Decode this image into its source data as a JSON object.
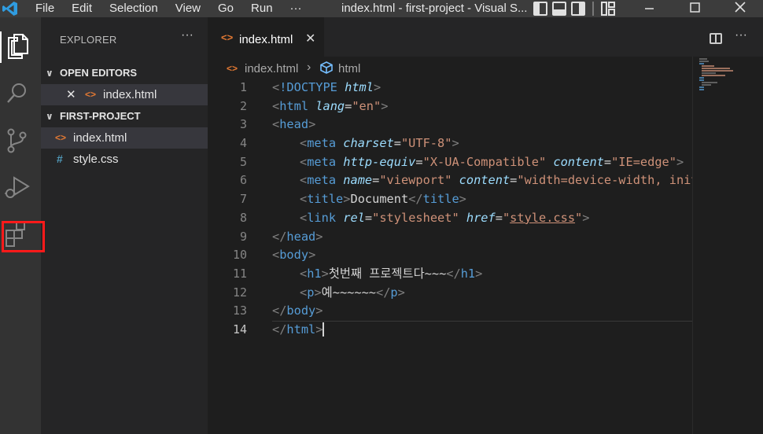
{
  "titlebar": {
    "menu": [
      "File",
      "Edit",
      "Selection",
      "View",
      "Go",
      "Run",
      "···"
    ],
    "window_title": "index.html - first-project - Visual S..."
  },
  "activity_bar": {
    "items": [
      "explorer-icon",
      "search-icon",
      "source-control-icon",
      "run-debug-icon",
      "extensions-icon"
    ],
    "highlight_color": "#ff1a1a"
  },
  "sidebar": {
    "title": "EXPLORER",
    "more": "···",
    "open_editors": {
      "label": "OPEN EDITORS",
      "items": [
        {
          "close": "✕",
          "icon": "<>",
          "name": "index.html"
        }
      ]
    },
    "project": {
      "label": "FIRST-PROJECT",
      "files": [
        {
          "icon": "<>",
          "name": "index.html"
        },
        {
          "icon": "#",
          "name": "style.css"
        }
      ]
    }
  },
  "editor": {
    "tab": {
      "icon": "<>",
      "label": "index.html",
      "close": "✕"
    },
    "tab_more": "···",
    "breadcrumb": {
      "file": "index.html",
      "separator": "›",
      "symbol": "html"
    },
    "line_numbers": [
      "1",
      "2",
      "3",
      "4",
      "5",
      "6",
      "7",
      "8",
      "9",
      "10",
      "11",
      "12",
      "13",
      "14"
    ],
    "current_line": 14,
    "code": {
      "doctype": "!DOCTYPE",
      "doctype_html": "html",
      "html": "html",
      "lang_attr": "lang",
      "lang_val": "\"en\"",
      "head": "head",
      "meta": "meta",
      "charset_attr": "charset",
      "charset_val": "\"UTF-8\"",
      "httpequiv_attr": "http-equiv",
      "httpequiv_val": "\"X-UA-Compatible\"",
      "content_attr": "content",
      "content_val1": "\"IE=edge\"",
      "name_attr": "name",
      "name_val": "\"viewport\"",
      "content_val2": "\"width=device-width, initia",
      "title": "title",
      "title_text": "Document",
      "link": "link",
      "rel_attr": "rel",
      "rel_val": "\"stylesheet\"",
      "href_attr": "href",
      "href_quote": "\"",
      "href_val": "style.css",
      "body": "body",
      "h1": "h1",
      "h1_text": "첫번째 프로젝트다~~~",
      "p": "p",
      "p_text": "예~~~~~~"
    }
  },
  "colors": {
    "background": "#1e1e1e",
    "tag": "#569cd6",
    "attribute": "#9cdcfe",
    "string": "#ce9178",
    "html_icon": "#e37933",
    "css_icon": "#519aba"
  }
}
